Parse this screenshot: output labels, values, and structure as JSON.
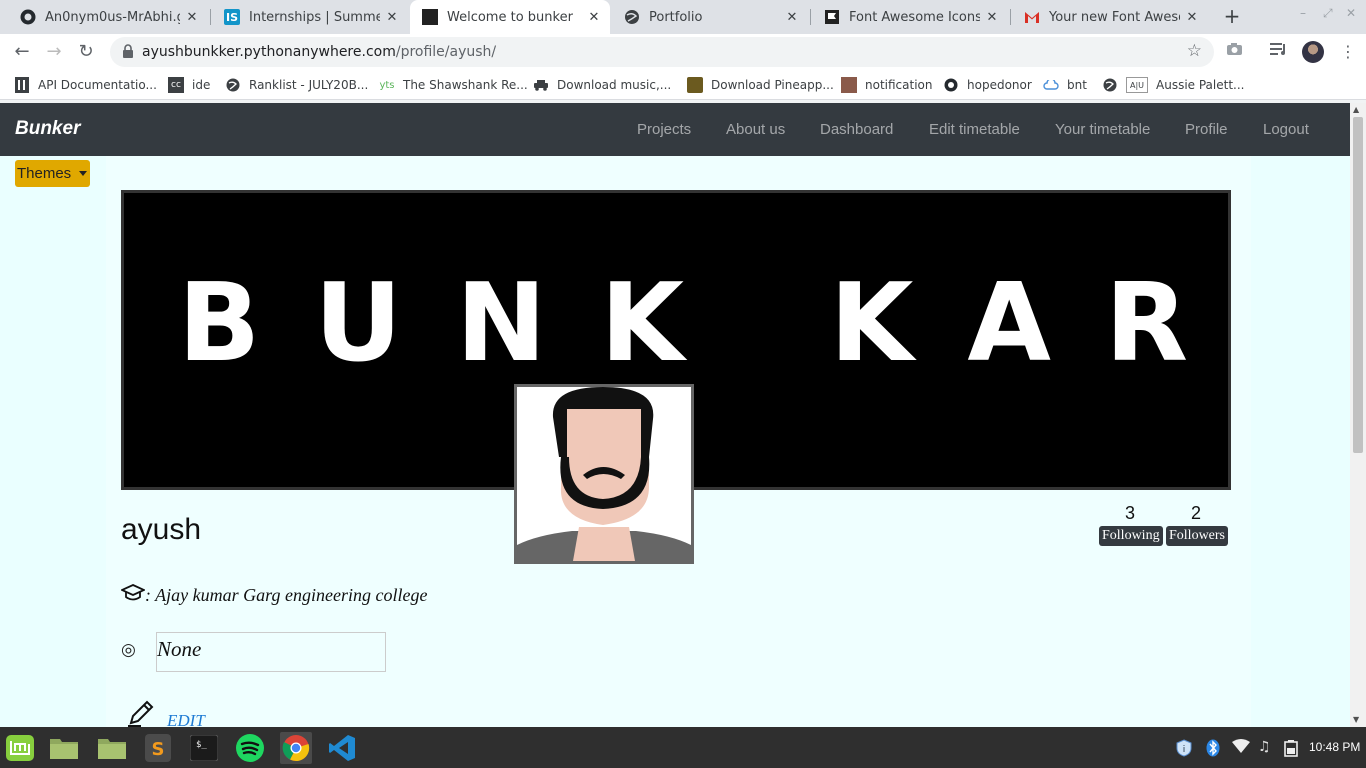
{
  "browser": {
    "tabs": [
      {
        "title": "An0nym0us-MrAbhi.gith",
        "icon": "github-icon"
      },
      {
        "title": "Internships | Summer In",
        "icon": "internshala-icon"
      },
      {
        "title": "Welcome to bunker",
        "icon": "bunker-icon",
        "active": true
      },
      {
        "title": "Portfolio",
        "icon": "globe-icon"
      },
      {
        "title": "Font Awesome Icons",
        "icon": "flag-icon"
      },
      {
        "title": "Your new Font Awesome",
        "icon": "gmail-icon"
      }
    ],
    "url_host": "ayushbunkker.pythonanywhere.com",
    "url_path": "/profile/ayush/",
    "bookmarks": [
      "API Documentatio...",
      "ide",
      "Ranklist - JULY20B...",
      "The Shawshank Re...",
      "Download music,...",
      "Download Pineapp...",
      "notification",
      "hopedonor",
      "bnt",
      "Aussie Palett..."
    ]
  },
  "site": {
    "brand": "Bunker",
    "nav": [
      "Projects",
      "About us",
      "Dashboard",
      "Edit timetable",
      "Your timetable",
      "Profile",
      "Logout"
    ],
    "themes_label": "Themes"
  },
  "profile": {
    "banner_text": "BUNK KAR",
    "username": "ayush",
    "following_count": "3",
    "following_label": "Following",
    "followers_count": "2",
    "followers_label": "Followers",
    "college": ": Ajay kumar Garg engineering college",
    "status": "None",
    "edit_label": "EDIT"
  },
  "system": {
    "time": "10:48 PM"
  },
  "colors": {
    "navbar": "#343a40",
    "themes_button": "#e0a800",
    "page_bg": "#eaffff",
    "edit_link": "#1e7bd4"
  }
}
